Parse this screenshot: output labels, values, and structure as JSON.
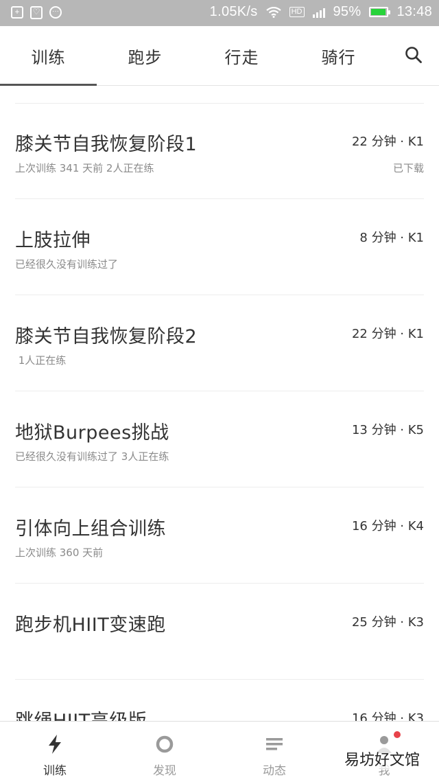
{
  "status_bar": {
    "speed": "1.05K/s",
    "network_badge": "HD",
    "battery_percent": "95%",
    "battery_level": 0.95,
    "time": "13:48",
    "battery_color": "#27d33a"
  },
  "tabs": [
    {
      "label": "训练",
      "active": true
    },
    {
      "label": "跑步",
      "active": false
    },
    {
      "label": "行走",
      "active": false
    },
    {
      "label": "骑行",
      "active": false
    }
  ],
  "search_icon": "search-icon",
  "workouts": [
    {
      "title": "膝关节自我恢复阶段1",
      "meta": "22 分钟 · K1",
      "sub": "上次训练 341 天前  2人正在练",
      "status": "已下载"
    },
    {
      "title": "上肢拉伸",
      "meta": "8 分钟 · K1",
      "sub": "已经很久没有训练过了",
      "status": ""
    },
    {
      "title": "膝关节自我恢复阶段2",
      "meta": "22 分钟 · K1",
      "sub": " 1人正在练",
      "status": ""
    },
    {
      "title": "地狱Burpees挑战",
      "meta": "13 分钟 · K5",
      "sub": "已经很久没有训练过了  3人正在练",
      "status": ""
    },
    {
      "title": "引体向上组合训练",
      "meta": "16 分钟 · K4",
      "sub": "上次训练 360 天前",
      "status": ""
    },
    {
      "title": "跑步机HIIT变速跑",
      "meta": "25 分钟 · K3",
      "sub": "",
      "status": ""
    },
    {
      "title": "跳绳HIIT高级版",
      "meta": "16 分钟 · K3",
      "sub": "",
      "status": ""
    }
  ],
  "bottom_nav": [
    {
      "label": "训练",
      "icon": "bolt-icon",
      "active": true
    },
    {
      "label": "发现",
      "icon": "ring-icon",
      "active": false
    },
    {
      "label": "动态",
      "icon": "feed-lines-icon",
      "active": false
    },
    {
      "label": "我",
      "icon": "person-icon",
      "active": false
    }
  ],
  "watermark": "易坊好文馆",
  "colors": {
    "status_bar_bg": "#b7b7b7",
    "notification_dot": "#e8434a",
    "tab_indicator": "#555555"
  }
}
